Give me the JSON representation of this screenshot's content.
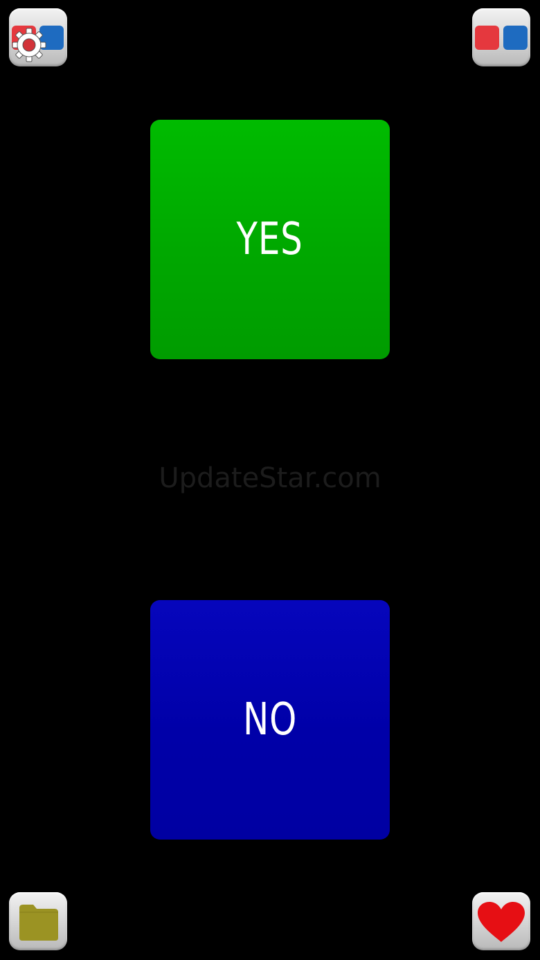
{
  "buttons": {
    "yes_label": "YES",
    "no_label": "NO"
  },
  "watermark": "UpdateStar.com",
  "icons": {
    "settings": "settings-gear-icon",
    "mode": "red-blue-squares-icon",
    "folder": "folder-icon",
    "favorite": "heart-icon"
  },
  "colors": {
    "yes": "#00b400",
    "no": "#0000b0",
    "red_square": "#e5383e",
    "blue_square": "#1e6bc0",
    "folder": "#9b9323",
    "heart": "#e60f14",
    "background": "#000000"
  }
}
